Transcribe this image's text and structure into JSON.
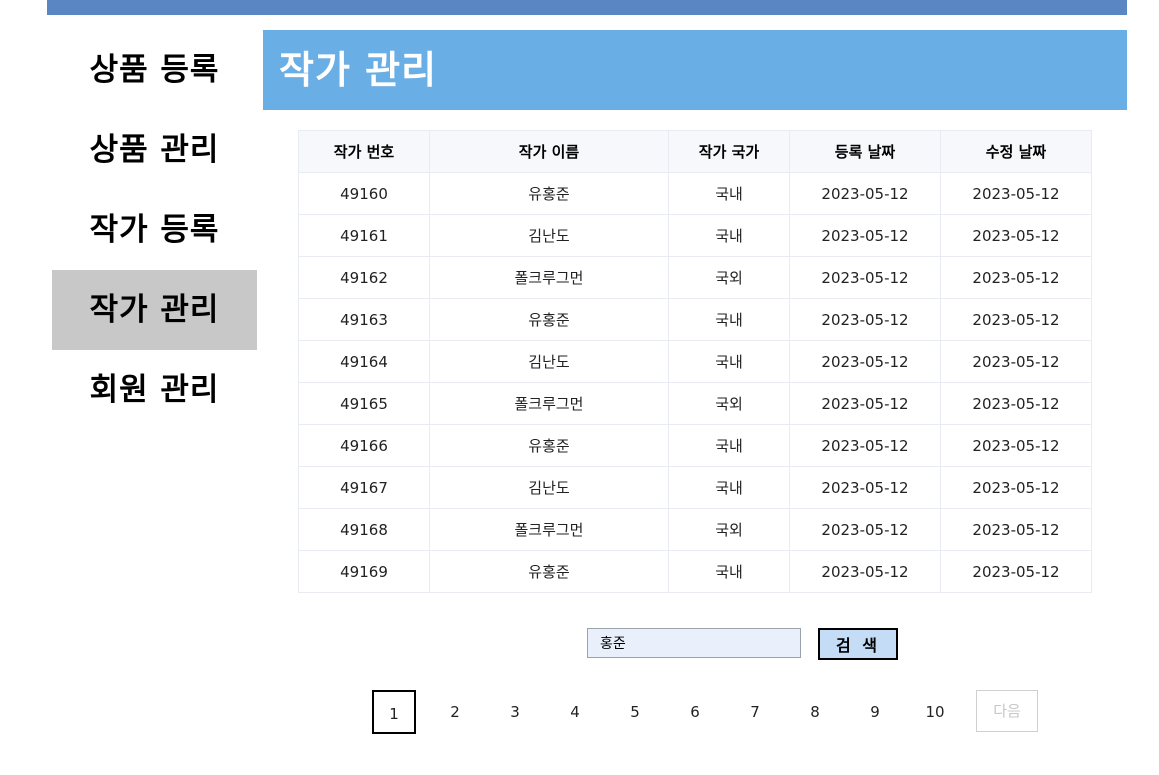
{
  "sidebar": {
    "items": [
      {
        "label": "상품 등록",
        "active": false
      },
      {
        "label": "상품 관리",
        "active": false
      },
      {
        "label": "작가 등록",
        "active": false
      },
      {
        "label": "작가 관리",
        "active": true
      },
      {
        "label": "회원 관리",
        "active": false
      }
    ]
  },
  "header": {
    "title": "작가 관리"
  },
  "table": {
    "columns": [
      "작가 번호",
      "작가 이름",
      "작가 국가",
      "등록 날짜",
      "수정 날짜"
    ],
    "rows": [
      [
        "49160",
        "유홍준",
        "국내",
        "2023-05-12",
        "2023-05-12"
      ],
      [
        "49161",
        "김난도",
        "국내",
        "2023-05-12",
        "2023-05-12"
      ],
      [
        "49162",
        "폴크루그먼",
        "국외",
        "2023-05-12",
        "2023-05-12"
      ],
      [
        "49163",
        "유홍준",
        "국내",
        "2023-05-12",
        "2023-05-12"
      ],
      [
        "49164",
        "김난도",
        "국내",
        "2023-05-12",
        "2023-05-12"
      ],
      [
        "49165",
        "폴크루그먼",
        "국외",
        "2023-05-12",
        "2023-05-12"
      ],
      [
        "49166",
        "유홍준",
        "국내",
        "2023-05-12",
        "2023-05-12"
      ],
      [
        "49167",
        "김난도",
        "국내",
        "2023-05-12",
        "2023-05-12"
      ],
      [
        "49168",
        "폴크루그먼",
        "국외",
        "2023-05-12",
        "2023-05-12"
      ],
      [
        "49169",
        "유홍준",
        "국내",
        "2023-05-12",
        "2023-05-12"
      ]
    ]
  },
  "search": {
    "value": "홍준",
    "button_label": "검 색"
  },
  "pagination": {
    "pages": [
      "1",
      "2",
      "3",
      "4",
      "5",
      "6",
      "7",
      "8",
      "9",
      "10"
    ],
    "current": "1",
    "next_label": "다음"
  },
  "colors": {
    "topbar": "#5b86c4",
    "header": "#6aaee6",
    "active_sidebar": "#c8c8c8",
    "search_button": "#c4dcf6"
  }
}
